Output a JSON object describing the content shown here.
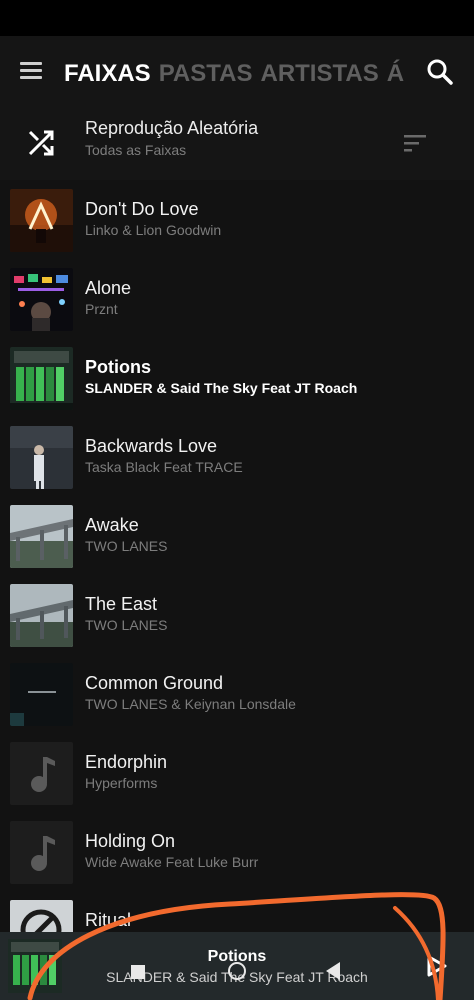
{
  "header": {
    "tabs": [
      {
        "label": "FAIXAS",
        "active": true
      },
      {
        "label": "PASTAS",
        "active": false
      },
      {
        "label": "ARTISTAS",
        "active": false
      },
      {
        "label": "Á",
        "active": false
      }
    ]
  },
  "shuffle": {
    "title": "Reprodução Aleatória",
    "subtitle": "Todas as Faixas"
  },
  "tracks": [
    {
      "title": "Don't Do Love",
      "artist": "Linko & Lion Goodwin"
    },
    {
      "title": "Alone",
      "artist": "Prznt"
    },
    {
      "title": "Potions",
      "artist": "SLANDER & Said The Sky Feat JT Roach",
      "playing": true
    },
    {
      "title": "Backwards Love",
      "artist": "Taska Black Feat TRACE"
    },
    {
      "title": "Awake",
      "artist": "TWO LANES"
    },
    {
      "title": "The East",
      "artist": "TWO LANES"
    },
    {
      "title": "Common Ground",
      "artist": "TWO LANES & Keiynan Lonsdale"
    },
    {
      "title": "Endorphin",
      "artist": "Hyperforms"
    },
    {
      "title": "Holding On",
      "artist": "Wide Awake Feat Luke Burr"
    },
    {
      "title": "Ritual",
      "artist": ""
    }
  ],
  "now_playing": {
    "title": "Potions",
    "artist": "SLANDER & Said The Sky Feat JT Roach"
  },
  "colors": {
    "background": "#121212",
    "app_bar": "#151515",
    "mini_player": "#23292b",
    "annotation_stroke": "#f26a2e",
    "text_secondary": "#7d7d7d"
  },
  "icons": {
    "menu": "menu-icon",
    "search": "search-icon",
    "shuffle": "shuffle-icon",
    "sort": "sort-icon",
    "placeholder_art": "music-note-icon",
    "play": "play-icon"
  }
}
